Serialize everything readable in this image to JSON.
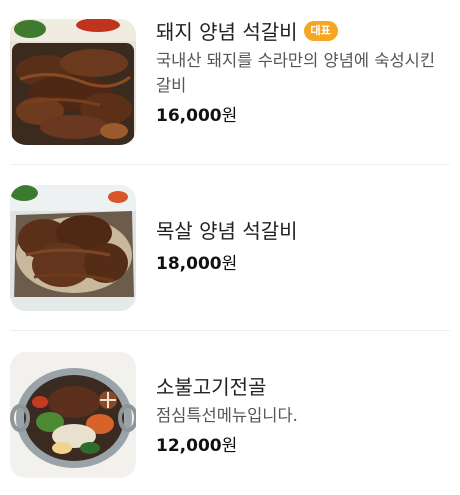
{
  "menu": {
    "items": [
      {
        "name": "돼지 양념 석갈비",
        "badge": "대표",
        "description": "국내산 돼지를 수라만의 양념에 숙성시킨 갈비",
        "price_value": "16,000",
        "price_unit": "원",
        "image": "pork-galbi-photo"
      },
      {
        "name": "목살 양념 석갈비",
        "price_value": "18,000",
        "price_unit": "원",
        "image": "pork-neck-galbi-photo"
      },
      {
        "name": "소불고기전골",
        "description": "점심특선메뉴입니다.",
        "price_value": "12,000",
        "price_unit": "원",
        "image": "beef-bulgogi-hotpot-photo"
      }
    ]
  },
  "colors": {
    "badge": "#f5a623",
    "divider": "#efefef",
    "text": "#222222",
    "muted": "#555555"
  }
}
